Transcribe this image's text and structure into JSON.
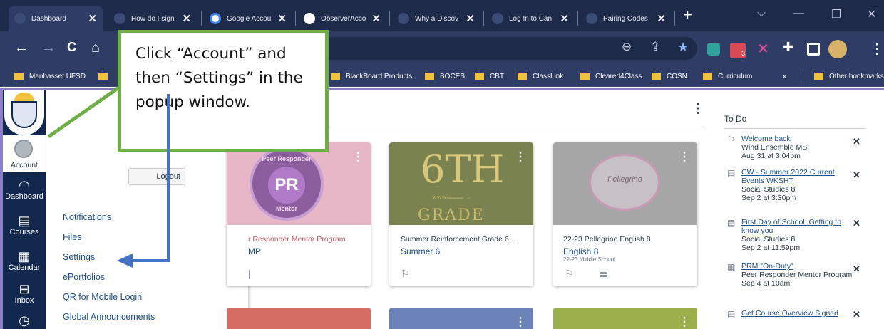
{
  "tabs": [
    {
      "title": "Dashboard",
      "active": true
    },
    {
      "title": "How do I sign",
      "active": false
    },
    {
      "title": "Google Accou",
      "active": false
    },
    {
      "title": "ObserverAcco",
      "active": false
    },
    {
      "title": "Why a Discov",
      "active": false
    },
    {
      "title": "Log In to Can",
      "active": false
    },
    {
      "title": "Pairing Codes",
      "active": false
    }
  ],
  "toolbar": {
    "back": "←",
    "forward": "→",
    "reload": "C",
    "home": "⌂"
  },
  "bookmarks": [
    "Manhasset UFSD",
    "BlackBoard Products",
    "BOCES",
    "CBT",
    "ClassLink",
    "Cleared4Class",
    "COSN",
    "Curriculum",
    "»",
    "Other bookmarks"
  ],
  "extension_badge": "3",
  "nav": {
    "account": "Account",
    "dashboard": "Dashboard",
    "courses": "Courses",
    "calendar": "Calendar",
    "inbox": "Inbox"
  },
  "account_panel": {
    "logout": "Logout",
    "links": [
      "Notifications",
      "Files",
      "Settings",
      "ePortfolios",
      "QR for Mobile Login",
      "Global Announcements"
    ]
  },
  "cards": [
    {
      "title": "r Responder Mentor Program",
      "code": "MP",
      "term": "",
      "logo": "PR",
      "logo_top": "Peer Responder",
      "logo_bottom": "Mentor"
    },
    {
      "title": "Summer Reinforcement Grade 6 ...",
      "code": "Summer 6",
      "term": "",
      "logo": "6TH",
      "logo_bottom": "GRADE"
    },
    {
      "title": "22-23 Pellegrino English 8",
      "code": "English 8",
      "term": "22-23 Middle School",
      "logo": "Pellegrino"
    }
  ],
  "todo": {
    "heading": "To Do",
    "items": [
      {
        "link": "Welcome back",
        "sub": [
          "Wind Ensemble MS",
          "Aug 31 at 3:04pm"
        ]
      },
      {
        "link": "CW - Summer 2022 Current Events WKSHT",
        "sub": [
          "Social Studies 8",
          "Sep 2 at 3:30pm"
        ]
      },
      {
        "link": "First Day of School: Getting to know you",
        "sub": [
          "Social Studies 8",
          "Sep 2 at 11:59pm"
        ]
      },
      {
        "link": "PRM \"On-Duty\"",
        "sub": [
          "Peer Responder Mentor Program",
          "Sep 4 at 10am"
        ]
      },
      {
        "link": "Get Course Overview Signed",
        "sub": []
      }
    ]
  },
  "callout": {
    "text": "Click “Account” and then “Settings” in the popup window."
  },
  "colors": {
    "nav": "#13284f",
    "link": "#1c4f8f",
    "callout_border": "#6fad47",
    "arrow": "#4472c4"
  }
}
